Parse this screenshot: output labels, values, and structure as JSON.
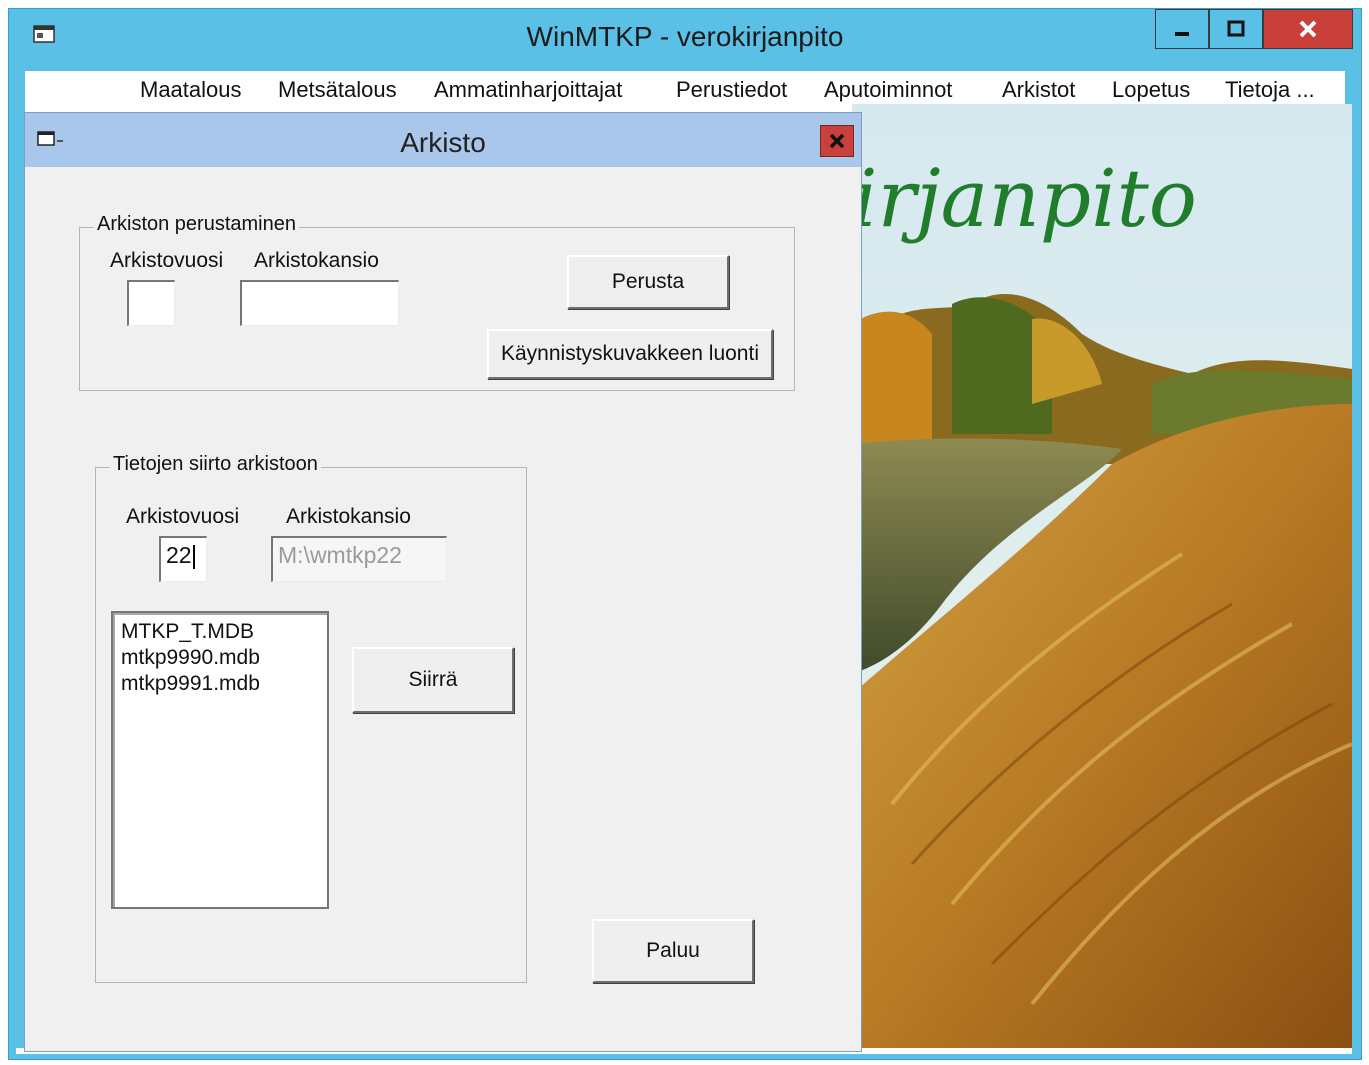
{
  "window": {
    "title": "WinMTKP - verokirjanpito"
  },
  "menu": [
    "Maatalous",
    "Metsätalous",
    "Ammatinharjoittajat",
    "Perustiedot",
    "Aputoiminnot",
    "Arkistot",
    "Lopetus",
    "Tietoja ..."
  ],
  "background": {
    "title_fragment": "irjanpito"
  },
  "dialog": {
    "title": "Arkisto",
    "archive_create": {
      "group_label": "Arkiston perustaminen",
      "year_label": "Arkistovuosi",
      "folder_label": "Arkistokansio",
      "year_value": "",
      "folder_value": "",
      "create_button": "Perusta",
      "shortcut_button": "Käynnistyskuvakkeen luonti"
    },
    "transfer": {
      "group_label": "Tietojen siirto arkistoon",
      "year_label": "Arkistovuosi",
      "folder_label": "Arkistokansio",
      "year_value": "22",
      "folder_value": "M:\\wmtkp22",
      "files": [
        "MTKP_T.MDB",
        "mtkp9990.mdb",
        "mtkp9991.mdb"
      ],
      "move_button": "Siirrä"
    },
    "back_button": "Paluu"
  },
  "colors": {
    "titlebar": "#5bc0e6",
    "dialog_titlebar": "#a9c7ea",
    "close": "#c9403b",
    "accent_text": "#1f7d2b"
  }
}
